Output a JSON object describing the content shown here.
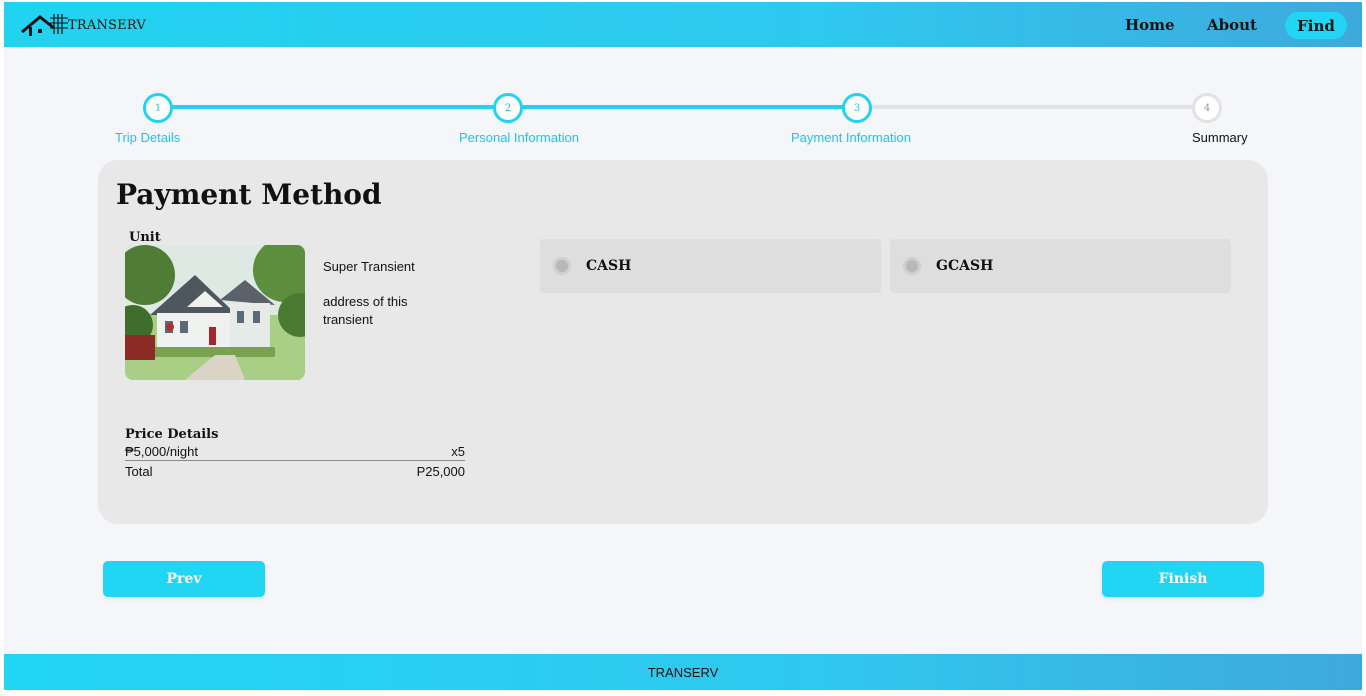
{
  "brand": {
    "logo_text": "TRANSERV"
  },
  "nav": {
    "home": "Home",
    "about": "About",
    "find": "Find"
  },
  "steps": [
    {
      "number": "1",
      "label": "Trip Details",
      "state": "done"
    },
    {
      "number": "2",
      "label": "Personal Information",
      "state": "done"
    },
    {
      "number": "3",
      "label": "Payment Information",
      "state": "active"
    },
    {
      "number": "4",
      "label": "Summary",
      "state": "pending"
    }
  ],
  "card": {
    "title": "Payment Method",
    "unit_label": "Unit",
    "unit_name": "Super Transient",
    "unit_address": "address of this transient",
    "payment_options": [
      "CASH",
      "GCASH"
    ],
    "price_title": "Price Details",
    "rate": "₱5,000/night",
    "nights": "x5",
    "total_label": "Total",
    "total_value": "P25,000"
  },
  "buttons": {
    "prev": "Prev",
    "finish": "Finish"
  },
  "footer": {
    "text": "TRANSERV"
  },
  "colors": {
    "accent": "#22d3f0",
    "inactive": "#e2e2e2",
    "card_bg": "#e8e8e8"
  }
}
